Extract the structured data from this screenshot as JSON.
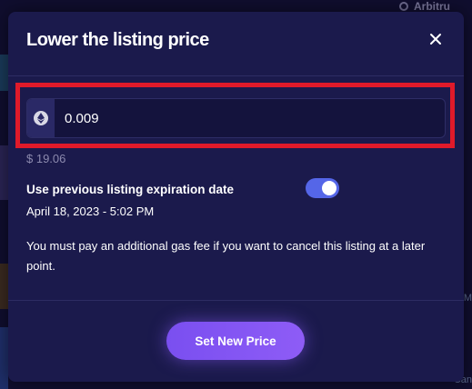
{
  "background": {
    "network_label": "Arbitru",
    "side_text_1": "M",
    "side_text_2": "Can"
  },
  "modal": {
    "title": "Lower the listing price",
    "close_icon": "close-icon",
    "price": {
      "currency_icon": "ethereum-icon",
      "value": "0.009",
      "usd_value": "$ 19.06"
    },
    "expiration": {
      "label": "Use previous listing expiration date",
      "toggle_on": true,
      "date": "April 18, 2023 - 5:02 PM"
    },
    "gas_note": "You must pay an additional gas fee if you want to cancel this listing at a later point.",
    "submit_label": "Set New Price"
  },
  "colors": {
    "modal_bg": "#1b1a4c",
    "accent": "#8e5cf6",
    "toggle": "#5566e8",
    "highlight": "#e01a2a"
  }
}
